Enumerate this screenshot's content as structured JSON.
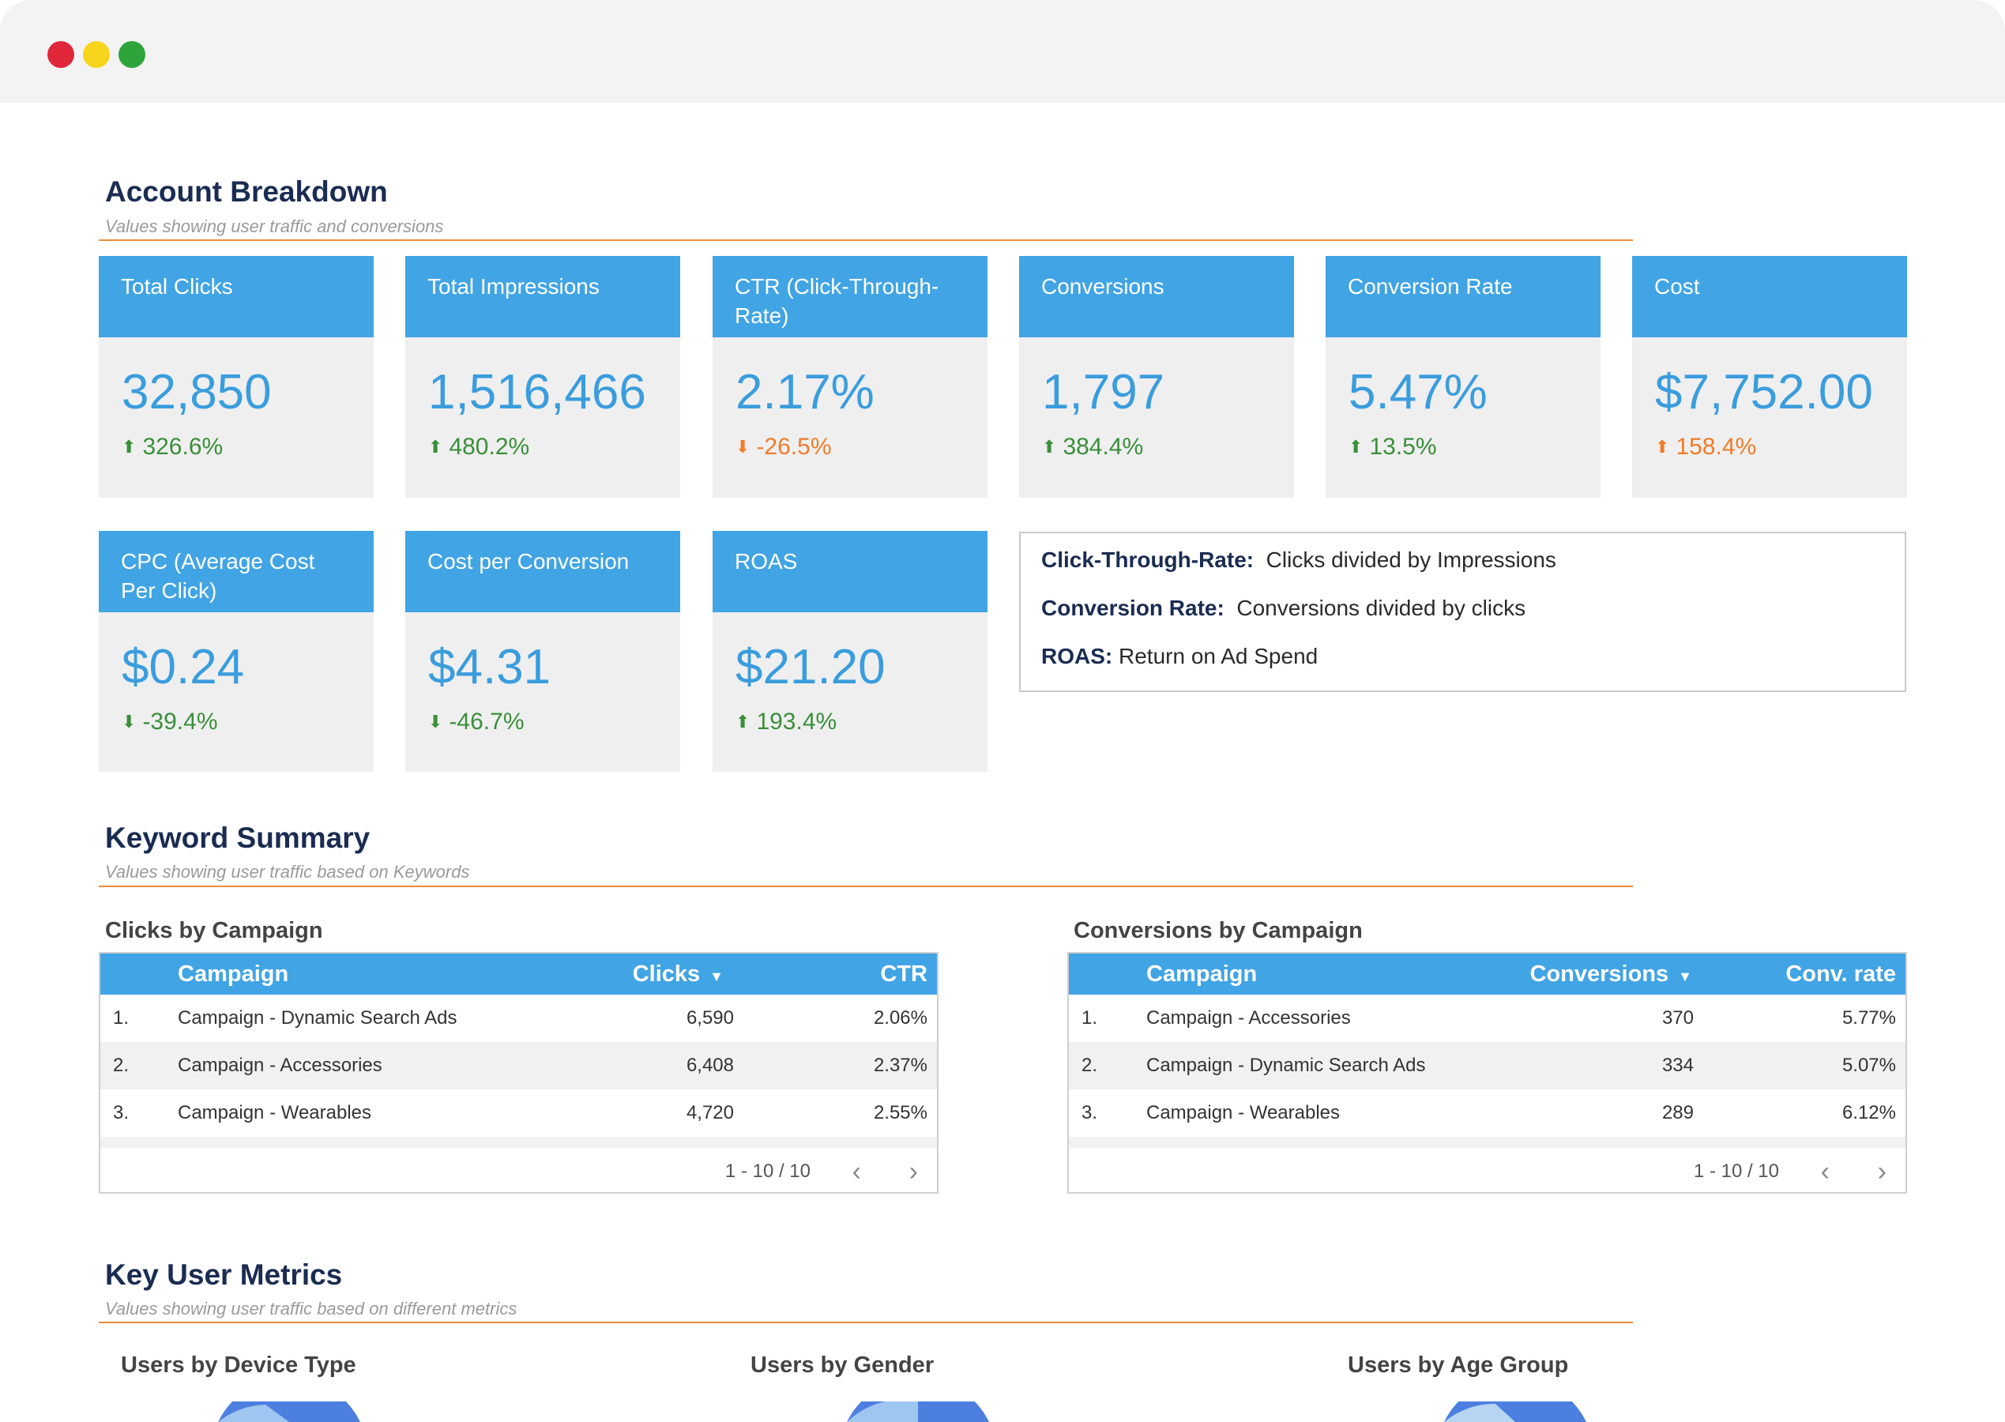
{
  "colors": {
    "accent": "#41a4e4",
    "value": "#3a9ddd",
    "up_good": "#3a8f3a",
    "bad": "#f07c2a",
    "heading": "#1a2c52",
    "rule": "#f08b3e"
  },
  "window": {
    "dots": [
      "red-dot",
      "yellow-dot",
      "green-dot"
    ]
  },
  "account": {
    "title": "Account Breakdown",
    "subtitle": "Values showing user traffic and conversions",
    "cards": [
      {
        "label": "Total Clicks",
        "value": "32,850",
        "delta": "326.6%",
        "direction": "up",
        "tone": "good"
      },
      {
        "label": "Total Impressions",
        "value": "1,516,466",
        "delta": "480.2%",
        "direction": "up",
        "tone": "good"
      },
      {
        "label": "CTR (Click-Through-Rate)",
        "value": "2.17%",
        "delta": "-26.5%",
        "direction": "down",
        "tone": "bad"
      },
      {
        "label": "Conversions",
        "value": "1,797",
        "delta": "384.4%",
        "direction": "up",
        "tone": "good"
      },
      {
        "label": "Conversion Rate",
        "value": "5.47%",
        "delta": "13.5%",
        "direction": "up",
        "tone": "good"
      },
      {
        "label": "Cost",
        "value": "$7,752.00",
        "delta": "158.4%",
        "direction": "up",
        "tone": "bad"
      },
      {
        "label": "CPC (Average Cost Per Click)",
        "value": "$0.24",
        "delta": "-39.4%",
        "direction": "down",
        "tone": "good"
      },
      {
        "label": "Cost per Conversion",
        "value": "$4.31",
        "delta": "-46.7%",
        "direction": "down",
        "tone": "good"
      },
      {
        "label": "ROAS",
        "value": "$21.20",
        "delta": "193.4%",
        "direction": "up",
        "tone": "good"
      }
    ],
    "definitions": [
      {
        "term": "Click-Through-Rate:",
        "text": "Clicks divided by Impressions"
      },
      {
        "term": "Conversion Rate:",
        "text": "Conversions divided by clicks"
      },
      {
        "term": "ROAS:",
        "text": "Return on Ad Spend"
      }
    ]
  },
  "keyword": {
    "title": "Keyword Summary",
    "subtitle": "Values showing user traffic based on Keywords",
    "clicks_table": {
      "title": "Clicks by Campaign",
      "headers": [
        "Campaign",
        "Clicks",
        "CTR"
      ],
      "sort_icon": "sort-down-icon",
      "rows": [
        {
          "n": "1.",
          "campaign": "Campaign - Dynamic Search Ads",
          "metric": "6,590",
          "rate": "2.06%"
        },
        {
          "n": "2.",
          "campaign": "Campaign - Accessories",
          "metric": "6,408",
          "rate": "2.37%"
        },
        {
          "n": "3.",
          "campaign": "Campaign - Wearables",
          "metric": "4,720",
          "rate": "2.55%"
        }
      ],
      "pager": "1 - 10 / 10"
    },
    "conversions_table": {
      "title": "Conversions by Campaign",
      "headers": [
        "Campaign",
        "Conversions",
        "Conv. rate"
      ],
      "sort_icon": "sort-down-icon",
      "rows": [
        {
          "n": "1.",
          "campaign": "Campaign - Accessories",
          "metric": "370",
          "rate": "5.77%"
        },
        {
          "n": "2.",
          "campaign": "Campaign - Dynamic Search Ads",
          "metric": "334",
          "rate": "5.07%"
        },
        {
          "n": "3.",
          "campaign": "Campaign - Wearables",
          "metric": "289",
          "rate": "6.12%"
        }
      ],
      "pager": "1 - 10 / 10"
    }
  },
  "metrics": {
    "title": "Key User Metrics",
    "subtitle": "Values showing user traffic based on different metrics",
    "charts": [
      "Users by Device Type",
      "Users by Gender",
      "Users by Age Group"
    ]
  }
}
